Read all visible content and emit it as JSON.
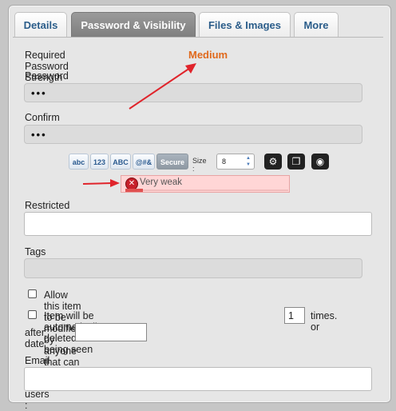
{
  "tabs": [
    {
      "label": "Details"
    },
    {
      "label": "Password & Visibility"
    },
    {
      "label": "Files & Images"
    },
    {
      "label": "More"
    }
  ],
  "required_strength": {
    "label": "Required Password Strength",
    "value": "Medium",
    "value_color": "#e0691c"
  },
  "password": {
    "label": "Password :",
    "value": "•••"
  },
  "confirm": {
    "label": "Confirm :",
    "value": "•••"
  },
  "generator": {
    "options": [
      "abc",
      "123",
      "ABC",
      "@#&",
      "Secure"
    ],
    "size_label": "Size :",
    "size_value": "8",
    "icons": [
      "settings-icon",
      "copy-icon",
      "eye-icon"
    ]
  },
  "strength_meter": {
    "text": "Very weak",
    "level": 0.1
  },
  "restricted": {
    "label": "Restricted to :",
    "value": ""
  },
  "tags": {
    "label": "Tags :",
    "value": ""
  },
  "checkbox_modify": {
    "label": "Allow this item to be modified by anyone that can access it",
    "checked": false
  },
  "checkbox_delete": {
    "label_before": "Item will be automatically deleted after being seen",
    "times_value": "1",
    "label_after": "times.  or",
    "after_date_label": "after date",
    "date_value": "",
    "checked": false
  },
  "email": {
    "label": "Email a link to all users :",
    "value": ""
  },
  "colors": {
    "annotation_arrow": "#e0242b",
    "active_tab": "#8a8a8a"
  }
}
